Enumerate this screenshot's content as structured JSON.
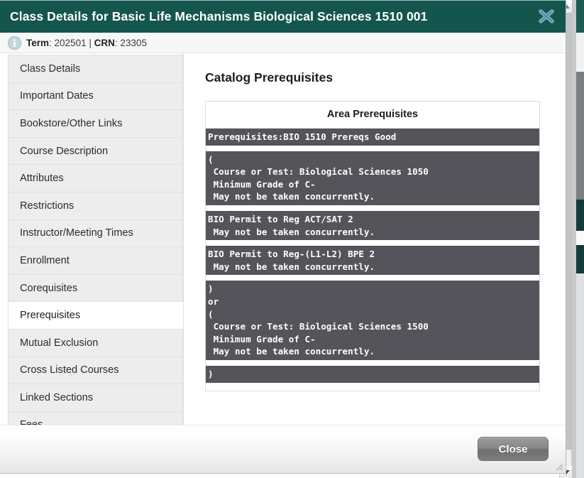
{
  "window": {
    "title": "Class Details for Basic Life Mechanisms Biological Sciences 1510 001",
    "close_icon": "close-x-icon",
    "titlebar_color": "#14564d",
    "close_icon_color": "#7fb2c4"
  },
  "info_bar": {
    "icon": "info-circle-icon",
    "term_label": "Term",
    "term_value": "202501",
    "separator": "|",
    "crn_label": "CRN",
    "crn_value": "23305",
    "full_text": "Term: 202501 | CRN: 23305"
  },
  "sidebar": {
    "items": [
      {
        "label": "Class Details",
        "active": false
      },
      {
        "label": "Important Dates",
        "active": false
      },
      {
        "label": "Bookstore/Other Links",
        "active": false
      },
      {
        "label": "Course Description",
        "active": false
      },
      {
        "label": "Attributes",
        "active": false
      },
      {
        "label": "Restrictions",
        "active": false
      },
      {
        "label": "Instructor/Meeting Times",
        "active": false
      },
      {
        "label": "Enrollment",
        "active": false
      },
      {
        "label": "Corequisites",
        "active": false
      },
      {
        "label": "Prerequisites",
        "active": true
      },
      {
        "label": "Mutual Exclusion",
        "active": false
      },
      {
        "label": "Cross Listed Courses",
        "active": false
      },
      {
        "label": "Linked Sections",
        "active": false
      },
      {
        "label": "Fees",
        "active": false
      }
    ]
  },
  "content": {
    "heading": "Catalog Prerequisites",
    "table_header": "Area Prerequisites",
    "block_bg_color": "#54545a",
    "blocks": [
      {
        "text": "Prerequisites:BIO 1510 Prereqs Good",
        "gap_after": "short"
      },
      {
        "text": "(\n Course or Test: Biological Sciences 1050\n Minimum Grade of C-\n May not be taken concurrently.",
        "gap_after": "short"
      },
      {
        "text": "BIO Permit to Reg ACT/SAT 2\n May not be taken concurrently.",
        "gap_after": "short"
      },
      {
        "text": "BIO Permit to Reg-(L1-L2) BPE 2\n May not be taken concurrently.",
        "gap_after": "short"
      },
      {
        "text": ")\nor\n(\n Course or Test: Biological Sciences 1500\n Minimum Grade of C-\n May not be taken concurrently.",
        "gap_after": "short"
      },
      {
        "text": ")",
        "gap_after": "tall"
      }
    ]
  },
  "footer": {
    "close_label": "Close",
    "resize_grip_icon": "resize-grip-icon"
  },
  "scrollbar": {
    "up_arrow_icon": "scroll-up-arrow-icon",
    "down_arrow_icon": "scroll-down-arrow-icon",
    "thumb_icon": "scrollbar-thumb"
  }
}
